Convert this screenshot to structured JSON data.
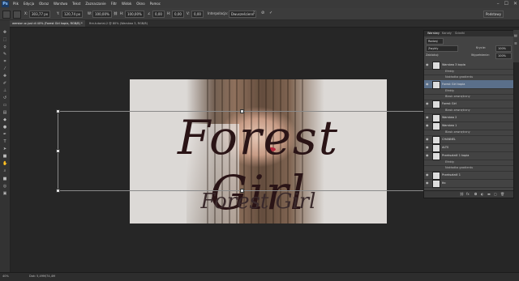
{
  "menubar": {
    "app_logo": "Ps",
    "items": [
      "Plik",
      "Edycja",
      "Obraz",
      "Warstwa",
      "Tekst",
      "Zaznaczanie",
      "Filtr",
      "Widok",
      "Okno",
      "Pomoc"
    ],
    "window_controls": [
      "–",
      "☐",
      "✕"
    ]
  },
  "options": {
    "x_label": "X:",
    "x_value": "303,77 px",
    "w_label": "W:",
    "w_value": "100,00%",
    "y_label": "Y:",
    "y_value": "120,74 px",
    "h_label": "H:",
    "h_value": "100,00%",
    "angle_value": "0,00",
    "h2_label": "H:",
    "h2_value": "0,00",
    "v_label": "V:",
    "v_value": "0,00",
    "interp_label": "Interpolacja:",
    "interp_value": "Dwusześcienn",
    "workspace": "Podstawy"
  },
  "tabs": [
    {
      "label": "wersion w-just di 40% (Forest Girl kopia, RGB/8) *",
      "active": true
    },
    {
      "label": "fire-tutorial-2 @ 80% (Warstwa 3, RGB/8)",
      "active": false
    }
  ],
  "document": {
    "title_big": "Forest Girl",
    "title_small": "Forest Girl"
  },
  "layers_panel": {
    "tabs": [
      "Warstwy",
      "Kanały",
      "Ścieżki"
    ],
    "kind_label": "Rodzaj",
    "mode_value": "Zwykły",
    "opacity_label": "Krycie:",
    "opacity_value": "100%",
    "lock_label": "Zablokuj:",
    "fill_label": "Wypełnienie:",
    "fill_value": "100%",
    "layers": [
      {
        "name": "Warstwa 3 kopia",
        "sub": false,
        "selected": false
      },
      {
        "name": "Efekty",
        "sub": true,
        "selected": false
      },
      {
        "name": "Nakładka gradientu",
        "sub": true,
        "selected": false
      },
      {
        "name": "Forest Girl kopia",
        "sub": false,
        "selected": true
      },
      {
        "name": "Efekty",
        "sub": true,
        "selected": false
      },
      {
        "name": "Blask zewnętrzny",
        "sub": true,
        "selected": false
      },
      {
        "name": "Forest Girl",
        "sub": false,
        "selected": false
      },
      {
        "name": "Blask zewnętrzny",
        "sub": true,
        "selected": false
      },
      {
        "name": "Warstwa 2",
        "sub": false,
        "selected": false
      },
      {
        "name": "Warstwa 1",
        "sub": false,
        "selected": false
      },
      {
        "name": "Blask zewnętrzny",
        "sub": true,
        "selected": false
      },
      {
        "name": "CHANNEL",
        "sub": false,
        "selected": false
      },
      {
        "name": "ALTS",
        "sub": false,
        "selected": false
      },
      {
        "name": "Przekształć 1 kopia",
        "sub": false,
        "selected": false
      },
      {
        "name": "Efekty",
        "sub": true,
        "selected": false
      },
      {
        "name": "Nakładka gradientu",
        "sub": true,
        "selected": false
      },
      {
        "name": "Przekształć 1",
        "sub": false,
        "selected": false
      },
      {
        "name": "tło",
        "sub": false,
        "selected": false
      }
    ],
    "footer_icons": [
      "link",
      "fx",
      "mask",
      "adjust",
      "folder",
      "new",
      "trash"
    ]
  },
  "status": {
    "zoom": "40%",
    "doc_size": "Dok: 5,49M/74,4M"
  }
}
